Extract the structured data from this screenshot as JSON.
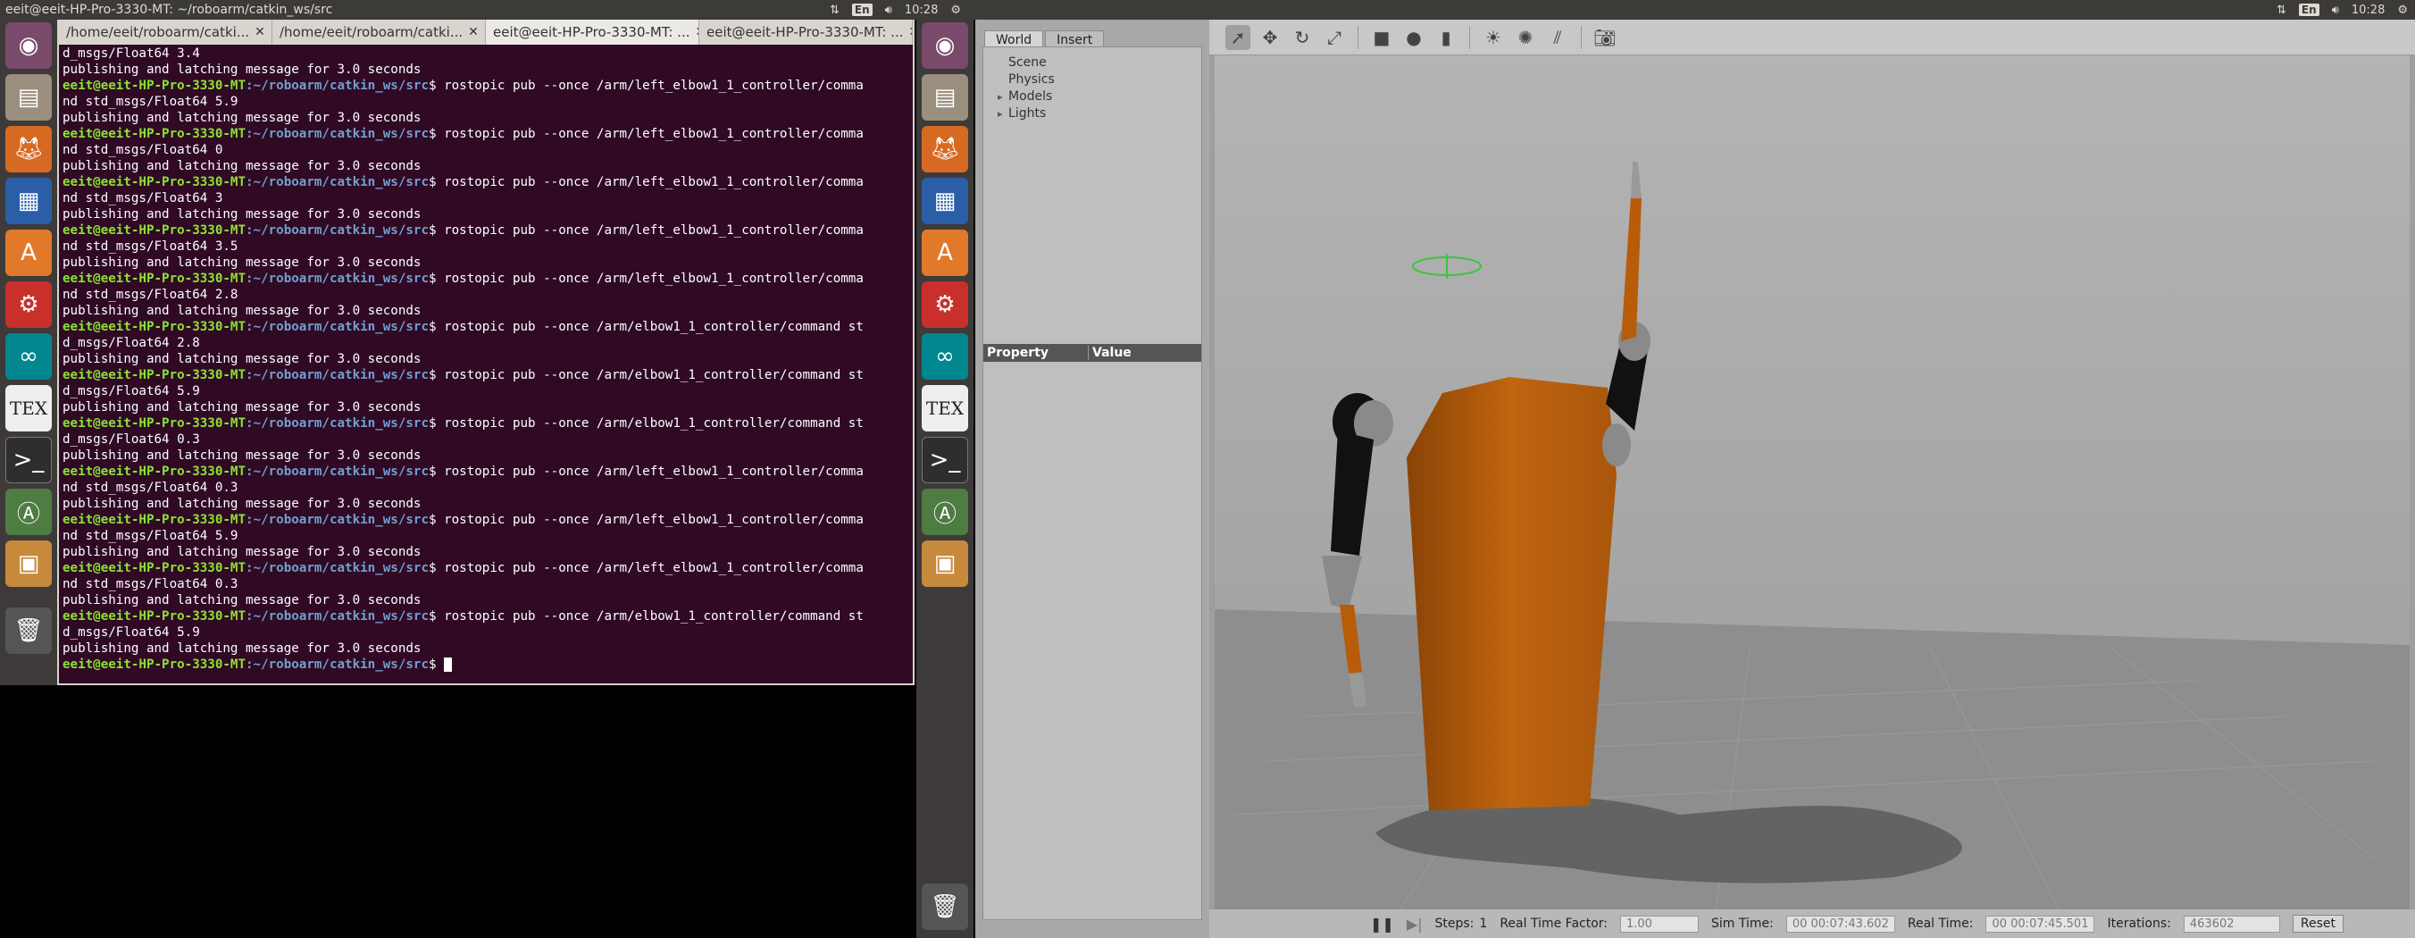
{
  "topbar": {
    "title": "eeit@eeit-HP-Pro-3330-MT: ~/roboarm/catkin_ws/src",
    "lang": "En",
    "time": "10:28"
  },
  "terminal": {
    "tabs": [
      {
        "label": "/home/eeit/roboarm/catki..."
      },
      {
        "label": "/home/eeit/roboarm/catki..."
      },
      {
        "label": "eeit@eeit-HP-Pro-3330-MT: ..."
      },
      {
        "label": "eeit@eeit-HP-Pro-3330-MT: ..."
      }
    ],
    "prompt_user": "eeit@eeit-HP-Pro-3330-MT",
    "prompt_path": ":~/roboarm/catkin_ws/src",
    "first_line": "d_msgs/Float64 3.4",
    "pub_msg": "publishing and latching message for 3.0 seconds",
    "entries": [
      {
        "cmd": "$ rostopic pub --once /arm/left_elbow1_1_controller/comma",
        "cont": "nd std_msgs/Float64 5.9"
      },
      {
        "cmd": "$ rostopic pub --once /arm/left_elbow1_1_controller/comma",
        "cont": "nd std_msgs/Float64 0"
      },
      {
        "cmd": "$ rostopic pub --once /arm/left_elbow1_1_controller/comma",
        "cont": "nd std_msgs/Float64 3"
      },
      {
        "cmd": "$ rostopic pub --once /arm/left_elbow1_1_controller/comma",
        "cont": "nd std_msgs/Float64 3.5"
      },
      {
        "cmd": "$ rostopic pub --once /arm/left_elbow1_1_controller/comma",
        "cont": "nd std_msgs/Float64 2.8"
      },
      {
        "cmd": "$ rostopic pub --once /arm/elbow1_1_controller/command st",
        "cont": "d_msgs/Float64 2.8"
      },
      {
        "cmd": "$ rostopic pub --once /arm/elbow1_1_controller/command st",
        "cont": "d_msgs/Float64 5.9"
      },
      {
        "cmd": "$ rostopic pub --once /arm/elbow1_1_controller/command st",
        "cont": "d_msgs/Float64 0.3"
      },
      {
        "cmd": "$ rostopic pub --once /arm/left_elbow1_1_controller/comma",
        "cont": "nd std_msgs/Float64 0.3"
      },
      {
        "cmd": "$ rostopic pub --once /arm/left_elbow1_1_controller/comma",
        "cont": "nd std_msgs/Float64 5.9"
      },
      {
        "cmd": "$ rostopic pub --once /arm/left_elbow1_1_controller/comma",
        "cont": "nd std_msgs/Float64 0.3"
      },
      {
        "cmd": "$ rostopic pub --once /arm/elbow1_1_controller/command st",
        "cont": "d_msgs/Float64 5.9"
      }
    ],
    "last_prompt_tail": "$ "
  },
  "gazebo": {
    "tabs": [
      {
        "label": "World"
      },
      {
        "label": "Insert"
      }
    ],
    "tree": {
      "scene": "Scene",
      "physics": "Physics",
      "models": "Models",
      "lights": "Lights"
    },
    "property_header": "Property",
    "value_header": "Value",
    "status": {
      "steps_label": "Steps:",
      "steps_value": "1",
      "rtf_label": "Real Time Factor:",
      "rtf_value": "1.00",
      "sim_label": "Sim Time:",
      "sim_value": "00 00:07:43.602",
      "real_label": "Real Time:",
      "real_value": "00 00:07:45.501",
      "iter_label": "Iterations:",
      "iter_value": "463602",
      "reset_label": "Reset"
    }
  },
  "colors": {
    "terminal_bg": "#300a24",
    "prompt_green": "#8ae234",
    "prompt_blue": "#729fcf",
    "robot_orange": "#b85c0a",
    "robot_black": "#111111"
  }
}
